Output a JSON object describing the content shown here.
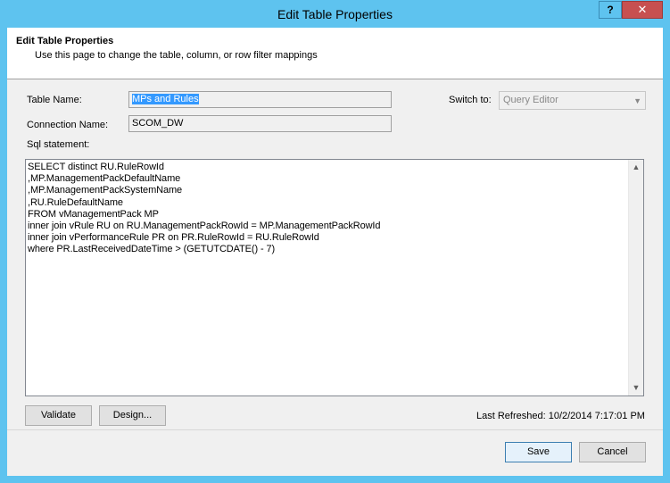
{
  "window": {
    "title": "Edit Table Properties",
    "help_glyph": "?",
    "close_glyph": "✕"
  },
  "header": {
    "title": "Edit Table Properties",
    "description": "Use this page to change the table, column, or row filter mappings"
  },
  "form": {
    "table_name_label": "Table Name:",
    "table_name_value": "MPs and Rules",
    "connection_name_label": "Connection Name:",
    "connection_name_value": "SCOM_DW",
    "switch_to_label": "Switch to:",
    "switch_to_value": "Query Editor",
    "sql_label": "Sql statement:",
    "sql_statement": "SELECT distinct RU.RuleRowId\n,MP.ManagementPackDefaultName\n,MP.ManagementPackSystemName\n,RU.RuleDefaultName\nFROM vManagementPack MP\ninner join vRule RU on RU.ManagementPackRowId = MP.ManagementPackRowId\ninner join vPerformanceRule PR on PR.RuleRowId = RU.RuleRowId\nwhere PR.LastReceivedDateTime > (GETUTCDATE() - 7)"
  },
  "actions": {
    "validate_label": "Validate",
    "design_label": "Design...",
    "last_refreshed": "Last Refreshed: 10/2/2014 7:17:01 PM"
  },
  "footer": {
    "save_label": "Save",
    "cancel_label": "Cancel"
  },
  "colors": {
    "titlebar": "#5ec3ef",
    "close_button": "#c75050",
    "selection": "#3399ff"
  }
}
